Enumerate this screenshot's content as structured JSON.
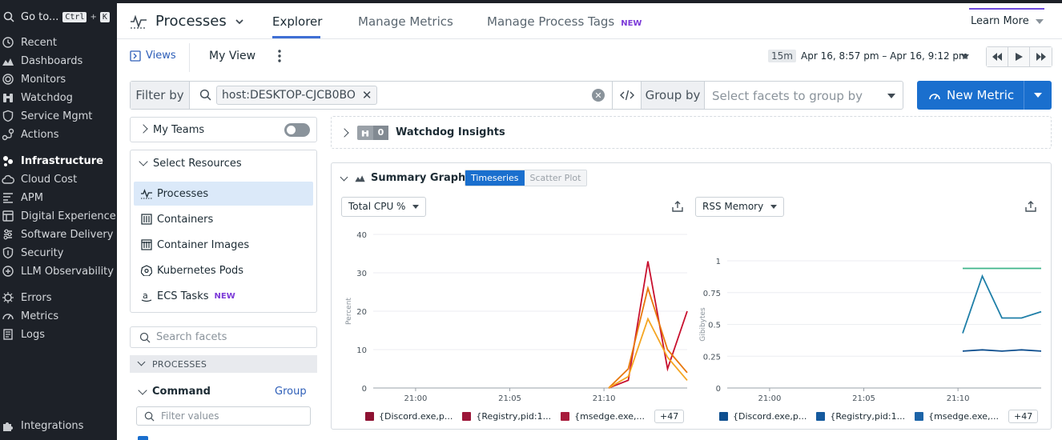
{
  "nav": {
    "goto_label": "Go to...",
    "goto_key1": "Ctrl",
    "goto_plus": "+",
    "goto_key2": "K",
    "items": [
      {
        "label": "Recent",
        "icon": "clock-icon"
      },
      {
        "label": "Dashboards",
        "icon": "dashboard-icon"
      },
      {
        "label": "Monitors",
        "icon": "monitor-icon"
      },
      {
        "label": "Watchdog",
        "icon": "binoculars-icon"
      },
      {
        "label": "Service Mgmt",
        "icon": "shield-icon"
      },
      {
        "label": "Actions",
        "icon": "actions-icon"
      },
      {
        "label": "Infrastructure",
        "icon": "infrastructure-icon"
      },
      {
        "label": "Cloud Cost",
        "icon": "cloud-icon"
      },
      {
        "label": "APM",
        "icon": "apm-icon"
      },
      {
        "label": "Digital Experience",
        "icon": "digital-experience-icon"
      },
      {
        "label": "Software Delivery",
        "icon": "delivery-icon"
      },
      {
        "label": "Security",
        "icon": "security-icon"
      },
      {
        "label": "LLM Observability",
        "icon": "llm-icon"
      },
      {
        "label": "Errors",
        "icon": "bug-icon"
      },
      {
        "label": "Metrics",
        "icon": "metrics-icon"
      },
      {
        "label": "Logs",
        "icon": "logs-icon"
      },
      {
        "label": "Integrations",
        "icon": "puzzle-icon"
      }
    ]
  },
  "header": {
    "title": "Processes",
    "tabs": [
      {
        "label": "Explorer",
        "active": true
      },
      {
        "label": "Manage Metrics",
        "active": false
      },
      {
        "label": "Manage Process Tags",
        "active": false,
        "badge": "NEW"
      }
    ],
    "learn_more": "Learn More"
  },
  "views": {
    "views_label": "Views",
    "current_view": "My View"
  },
  "time": {
    "badge": "15m",
    "range": "Apr 16, 8:57 pm – Apr 16, 9:12 pm"
  },
  "filter": {
    "filter_label": "Filter by",
    "chip": "host:DESKTOP-CJCB0BO",
    "group_label": "Group by",
    "group_placeholder": "Select facets to group by",
    "new_metric": "New Metric"
  },
  "sidebar": {
    "my_teams": "My Teams",
    "select_resources": "Select Resources",
    "resources": [
      {
        "label": "Processes",
        "selected": true,
        "icon": "processes-icon"
      },
      {
        "label": "Containers",
        "selected": false,
        "icon": "container-icon"
      },
      {
        "label": "Container Images",
        "selected": false,
        "icon": "container-image-icon"
      },
      {
        "label": "Kubernetes Pods",
        "selected": false,
        "icon": "kubernetes-icon"
      },
      {
        "label": "ECS Tasks",
        "selected": false,
        "icon": "aws-icon",
        "badge": "NEW"
      }
    ],
    "search_facets_placeholder": "Search facets",
    "section": "PROCESSES",
    "command_label": "Command",
    "group_link": "Group",
    "filter_values_placeholder": "Filter values"
  },
  "watchdog": {
    "count": "0",
    "title": "Watchdog Insights"
  },
  "summary": {
    "title": "Summary Graphs",
    "mode_on": "Timeseries",
    "mode_off": "Scatter Plot",
    "cpu_dropdown": "Total CPU %",
    "mem_dropdown": "RSS Memory",
    "cpu_legend": [
      {
        "label": "{Discord.exe,p...",
        "color": "#8e1232"
      },
      {
        "label": "{Registry,pid:1...",
        "color": "#9c1638"
      },
      {
        "label": "{msedge.exe,...",
        "color": "#a81c3c"
      }
    ],
    "mem_legend": [
      {
        "label": "{Discord.exe,p...",
        "color": "#0f4f8f"
      },
      {
        "label": "{Registry,pid:1...",
        "color": "#155a9e"
      },
      {
        "label": "{msedge.exe,...",
        "color": "#1d64a8"
      }
    ],
    "more_series": "+47"
  },
  "chart_data": [
    {
      "type": "line",
      "ylabel": "Percent",
      "xlabel": "",
      "ylim": [
        0,
        40
      ],
      "yticks": [
        "0",
        "10",
        "20",
        "30",
        "40"
      ],
      "xticks": [
        "21:00",
        "21:05",
        "21:10"
      ],
      "x": [
        "21:10",
        "21:10:30",
        "21:11",
        "21:11:30",
        "21:12"
      ],
      "series": [
        {
          "name": "{Discord.exe,p...",
          "color": "#c8102e",
          "values": [
            0,
            2,
            33,
            5,
            20
          ]
        },
        {
          "name": "{Registry,pid:1...",
          "color": "#e8780c",
          "values": [
            0,
            5,
            26,
            10,
            4
          ]
        },
        {
          "name": "{msedge.exe,...",
          "color": "#f5a623",
          "values": [
            0,
            3,
            18,
            8,
            2
          ]
        }
      ]
    },
    {
      "type": "line",
      "ylabel": "Gibibytes",
      "xlabel": "",
      "ylim": [
        0,
        1
      ],
      "yticks": [
        "0",
        "0.25",
        "0.5",
        "0.75",
        "1"
      ],
      "xticks": [
        "21:00",
        "21:05",
        "21:10"
      ],
      "x": [
        "21:10",
        "21:10:30",
        "21:11",
        "21:11:30",
        "21:12"
      ],
      "series": [
        {
          "name": "{Discord.exe,p...",
          "color": "#3fb58a",
          "values": [
            0.94,
            0.94,
            0.94,
            0.94,
            0.94
          ]
        },
        {
          "name": "{Registry,pid:1...",
          "color": "#1f7fa8",
          "values": [
            0.43,
            0.88,
            0.55,
            0.55,
            0.6
          ]
        },
        {
          "name": "{msedge.exe,...",
          "color": "#0f4f8f",
          "values": [
            0.29,
            0.3,
            0.29,
            0.3,
            0.29
          ]
        }
      ]
    }
  ]
}
